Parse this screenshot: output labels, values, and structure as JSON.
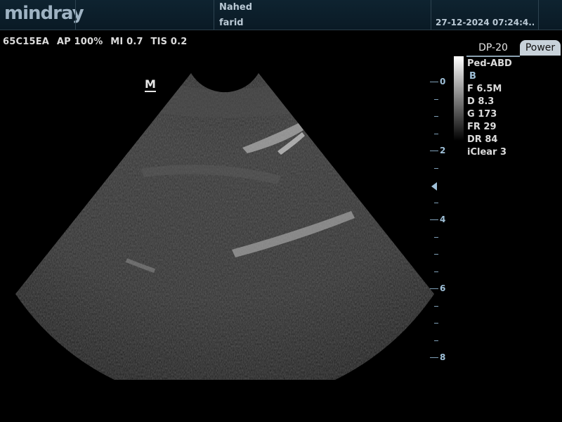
{
  "header": {
    "logo": "mindray",
    "patient_name": "Nahed",
    "patient_id": "farid",
    "datetime": "27-12-2024 07:24:4..."
  },
  "params": {
    "probe": "65C15EA",
    "ap": "AP 100%",
    "mi": "MI 0.7",
    "tis": "TIS 0.2"
  },
  "marker": "M",
  "tabs": {
    "dp": "DP-20",
    "power": "Power"
  },
  "imaging": {
    "preset": "Ped-ABD",
    "mode": "B",
    "frequency": "F 6.5M",
    "depth": "D 8.3",
    "gain": "G 173",
    "frame_rate": "FR 29",
    "dynamic_range": "DR 84",
    "iclear": "iClear 3"
  },
  "depth_scale": {
    "labels": [
      "0",
      "2",
      "4",
      "6",
      "8"
    ]
  },
  "colors": {
    "header_bg": "#0c1f2b",
    "scale_accent": "#9fc0d8",
    "text": "#dcdcdc"
  }
}
